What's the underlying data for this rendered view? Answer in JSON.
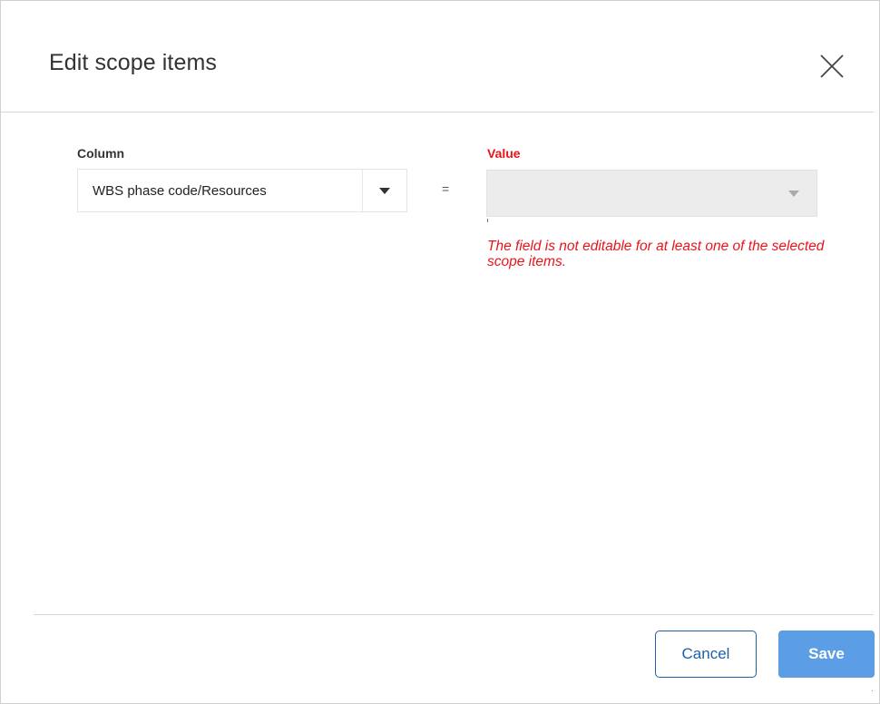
{
  "dialog": {
    "title": "Edit scope items",
    "close_icon": "close-icon"
  },
  "form": {
    "column_label": "Column",
    "column_value": "WBS phase code/Resources",
    "column_arrow_icon": "caret-down-icon",
    "operator": "=",
    "value_label": "Value",
    "value_value": "",
    "value_arrow_icon": "caret-down-icon",
    "error_message": "The field is not editable for at least one of the selected scope items."
  },
  "footer": {
    "cancel_label": "Cancel",
    "save_label": "Save"
  },
  "colors": {
    "accent": "#1f5fa8",
    "save_button": "#5b9ee6",
    "error": "#e8141b",
    "disabled_field": "#ececec"
  }
}
